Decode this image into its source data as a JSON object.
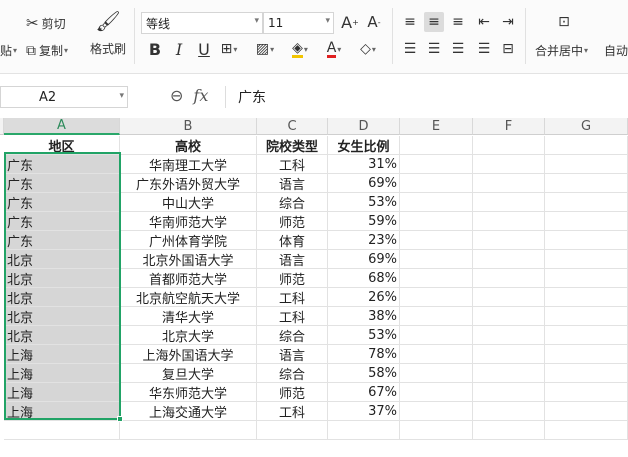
{
  "ribbon": {
    "paste_label": "贴",
    "cut_label": "剪切",
    "copy_label": "复制",
    "format_painter_label": "格式刷",
    "font_name": "等线",
    "font_size": "11",
    "merge_label": "合并居中",
    "auto_wrap_label": "自动"
  },
  "formula_bar": {
    "cell_ref": "A2",
    "content": "广东"
  },
  "columns": [
    "A",
    "B",
    "C",
    "D",
    "E",
    "F",
    "G"
  ],
  "header_row": [
    "地区",
    "高校",
    "院校类型",
    "女生比例"
  ],
  "rows": [
    [
      "广东",
      "华南理工大学",
      "工科",
      "31%"
    ],
    [
      "广东",
      "广东外语外贸大学",
      "语言",
      "69%"
    ],
    [
      "广东",
      "中山大学",
      "综合",
      "53%"
    ],
    [
      "广东",
      "华南师范大学",
      "师范",
      "59%"
    ],
    [
      "广东",
      "广州体育学院",
      "体育",
      "23%"
    ],
    [
      "北京",
      "北京外国语大学",
      "语言",
      "69%"
    ],
    [
      "北京",
      "首都师范大学",
      "师范",
      "68%"
    ],
    [
      "北京",
      "北京航空航天大学",
      "工科",
      "26%"
    ],
    [
      "北京",
      "清华大学",
      "工科",
      "38%"
    ],
    [
      "北京",
      "北京大学",
      "综合",
      "53%"
    ],
    [
      "上海",
      "上海外国语大学",
      "语言",
      "78%"
    ],
    [
      "上海",
      "复旦大学",
      "综合",
      "58%"
    ],
    [
      "上海",
      "华东师范大学",
      "师范",
      "67%"
    ],
    [
      "上海",
      "上海交通大学",
      "工科",
      "37%"
    ]
  ],
  "colors": {
    "selection": "#21a366",
    "selected_fill": "#d6d6d6"
  }
}
